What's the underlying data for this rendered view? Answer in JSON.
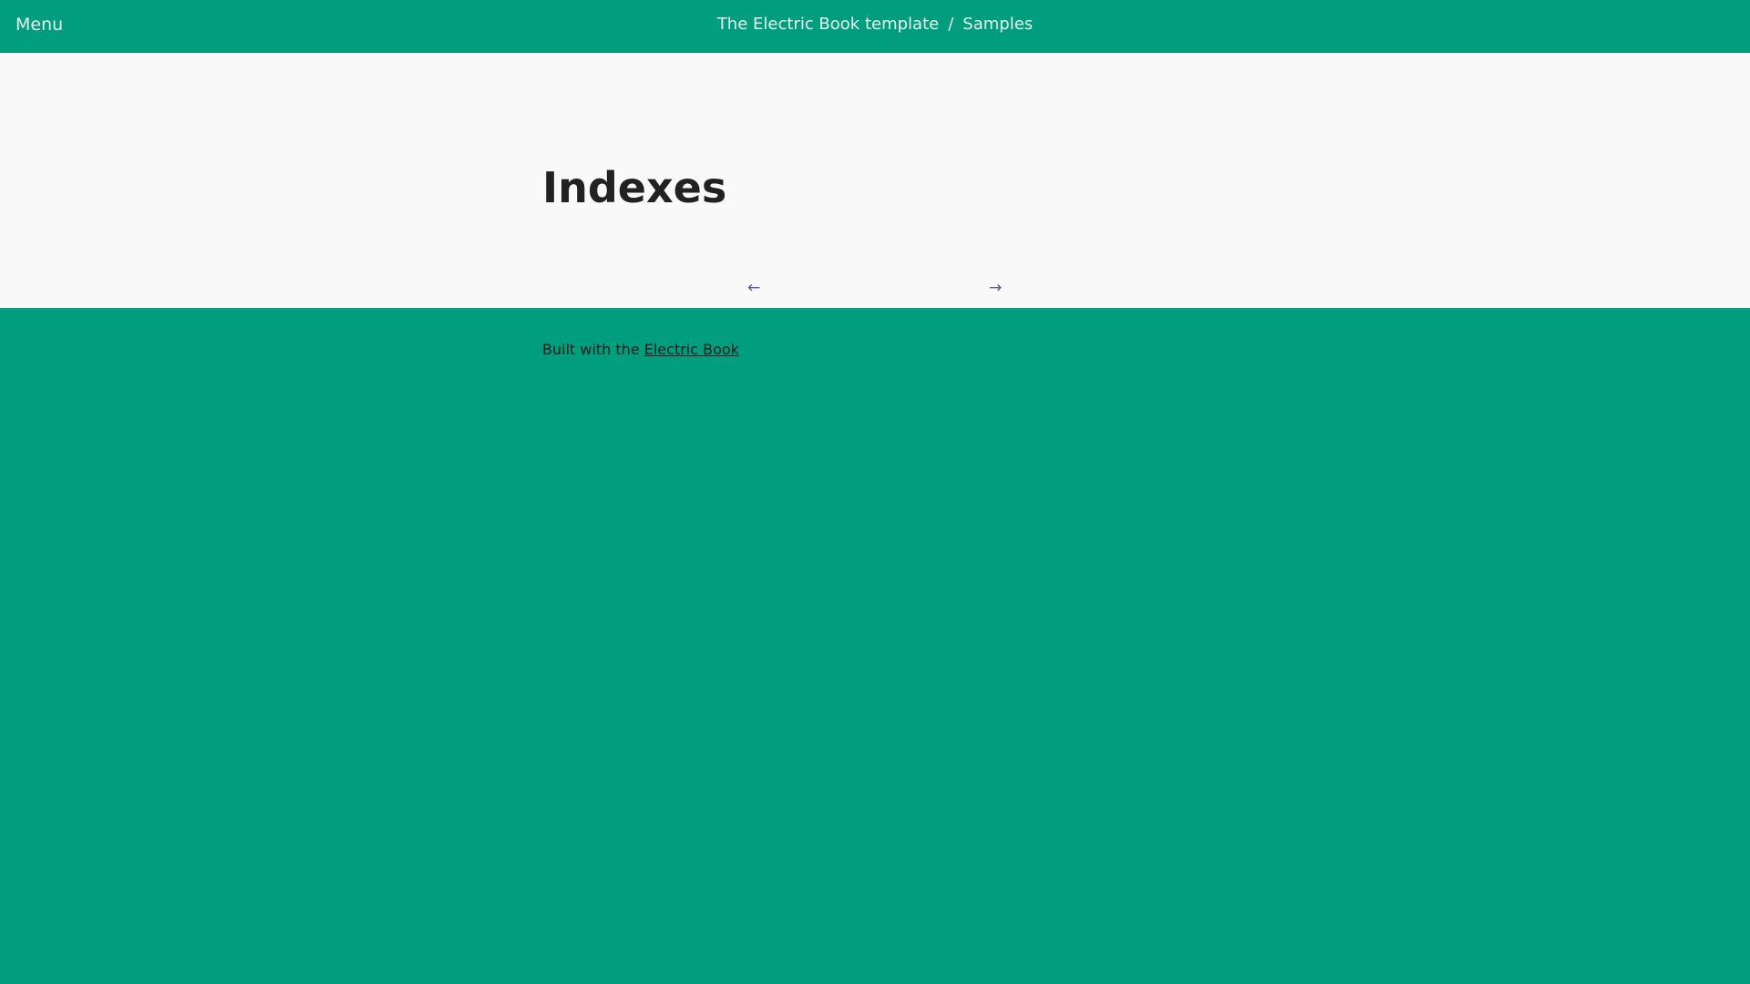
{
  "header": {
    "menu_label": "Menu",
    "breadcrumb": {
      "book": "The Electric Book template",
      "separator": "/",
      "section": "Samples"
    }
  },
  "main": {
    "title": "Indexes",
    "nav": {
      "prev_arrow": "←",
      "next_arrow": "→"
    }
  },
  "footer": {
    "text_prefix": "Built with the ",
    "link_label": "Electric Book"
  },
  "colors": {
    "brand": "#009e7e",
    "page_background": "#f9f9f9",
    "title_text": "#222222",
    "nav_link": "#5a5a9a"
  }
}
